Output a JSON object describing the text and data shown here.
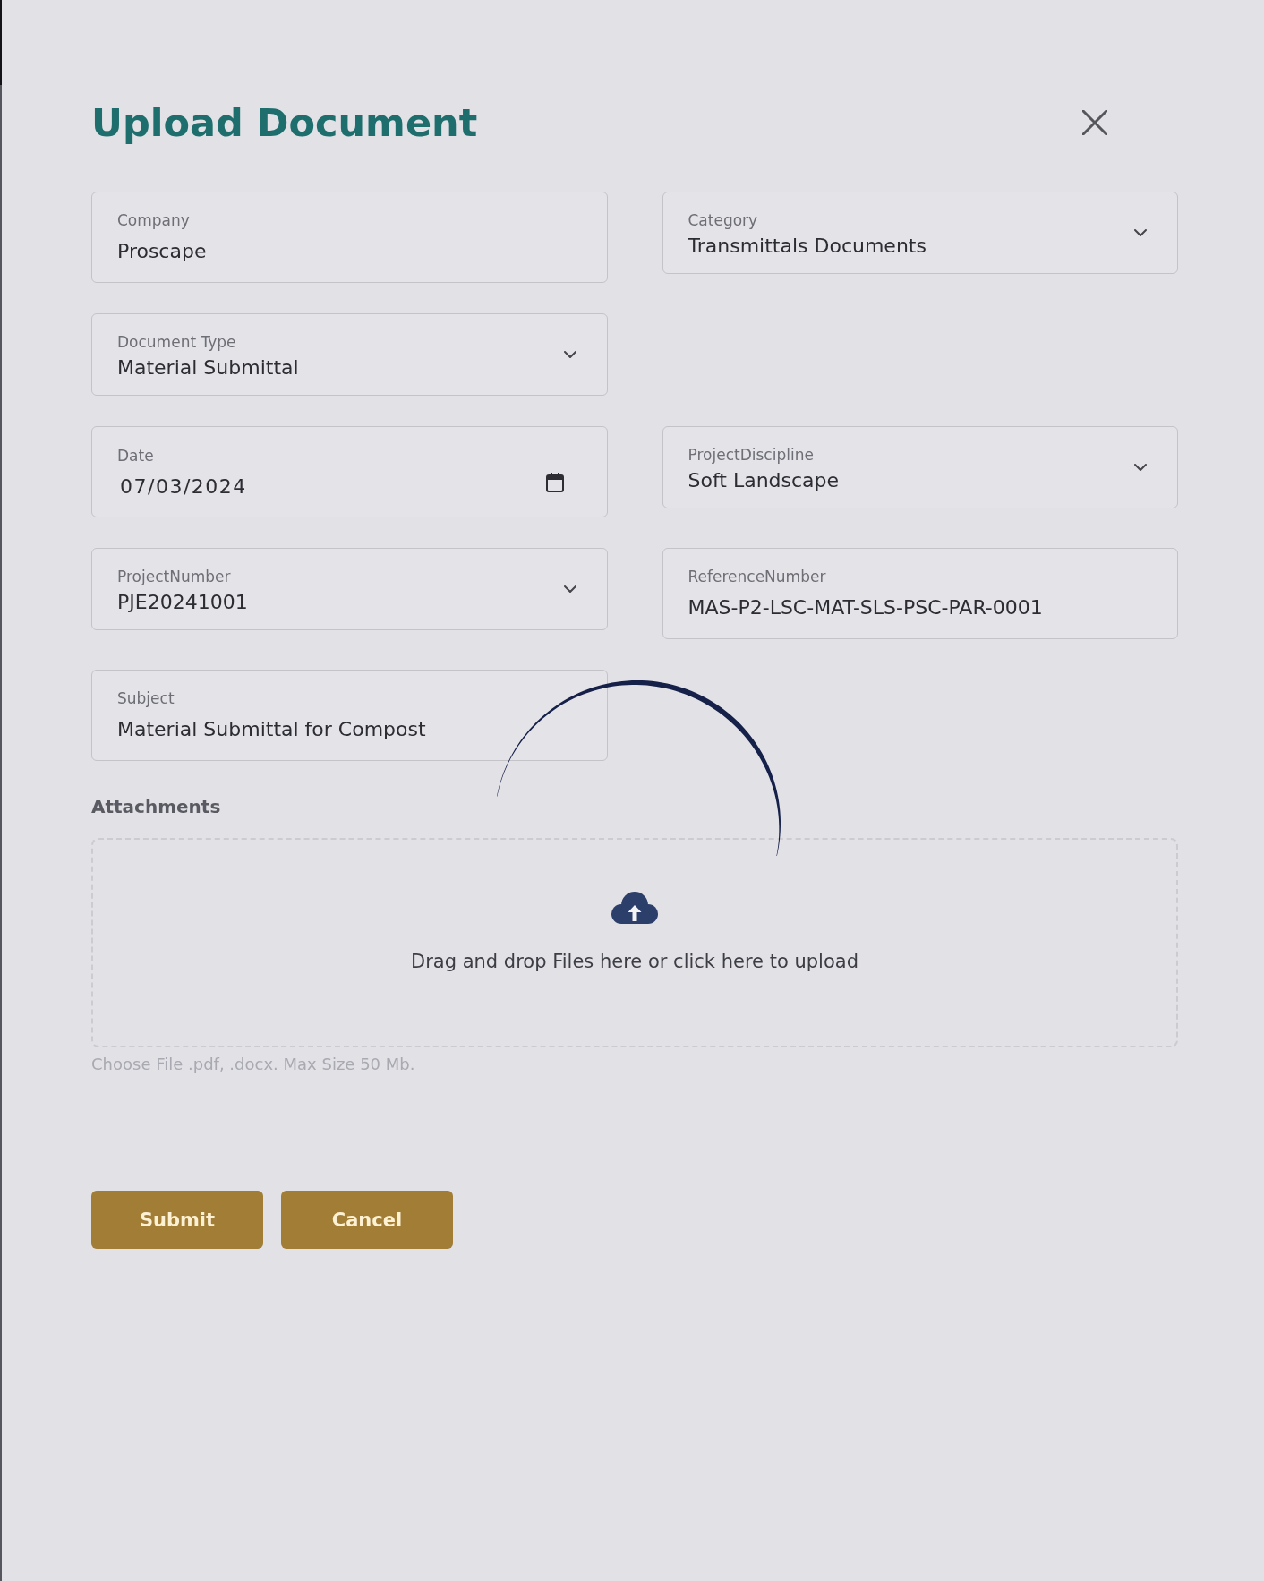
{
  "dialog": {
    "title": "Upload Document",
    "loading": true
  },
  "form_rows": [
    [
      {
        "kind": "text",
        "label": "Company",
        "value": "Proscape"
      },
      {
        "kind": "select",
        "label": "Category",
        "value": "Transmittals Documents"
      }
    ],
    [
      {
        "kind": "select",
        "label": "Document Type",
        "value": "Material Submittal"
      }
    ],
    [
      {
        "kind": "date",
        "label": "Date",
        "value": "07/03/2024"
      },
      {
        "kind": "select",
        "label": "ProjectDiscipline",
        "value": "Soft Landscape"
      }
    ],
    [
      {
        "kind": "select",
        "label": "ProjectNumber",
        "value": "PJE20241001"
      },
      {
        "kind": "text",
        "label": "ReferenceNumber",
        "value": "MAS-P2-LSC-MAT-SLS-PSC-PAR-0001"
      }
    ],
    [
      {
        "kind": "text",
        "label": "Subject",
        "value": "Material Submittal for Compost"
      }
    ]
  ],
  "attachments": {
    "label": "Attachments",
    "dropzone_text": "Drag and drop Files here or click here to upload",
    "hint": "Choose File .pdf, .docx. Max Size 50 Mb."
  },
  "buttons": [
    {
      "label": "Submit"
    },
    {
      "label": "Cancel"
    }
  ]
}
